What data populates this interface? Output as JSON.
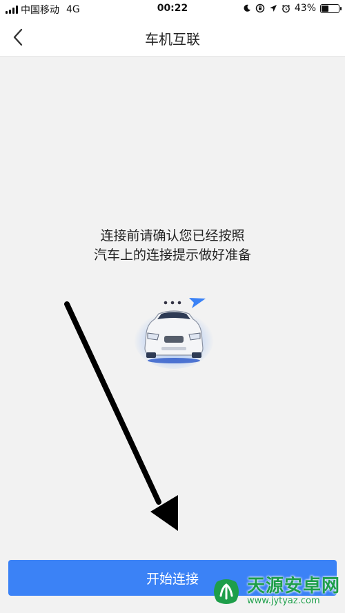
{
  "status_bar": {
    "carrier": "中国移动",
    "network": "4G",
    "time": "00:22",
    "battery_percent": "43%",
    "battery_level": 0.43,
    "icons": [
      "moon-icon",
      "rotation-lock-icon",
      "location-icon",
      "alarm-icon"
    ]
  },
  "nav": {
    "title": "车机互联",
    "back_icon": "chevron-left-icon"
  },
  "main": {
    "instruction_line1": "连接前请确认您已经按照",
    "instruction_line2": "汽车上的连接提示做好准备",
    "illustration": "car-connect-icon"
  },
  "footer": {
    "connect_label": "开始连接"
  },
  "watermark": {
    "title": "天源安卓网",
    "url": "www.jytyaz.com"
  },
  "colors": {
    "accent": "#3b82f6",
    "background": "#f2f2f2",
    "watermark": "#1e9e4a"
  }
}
